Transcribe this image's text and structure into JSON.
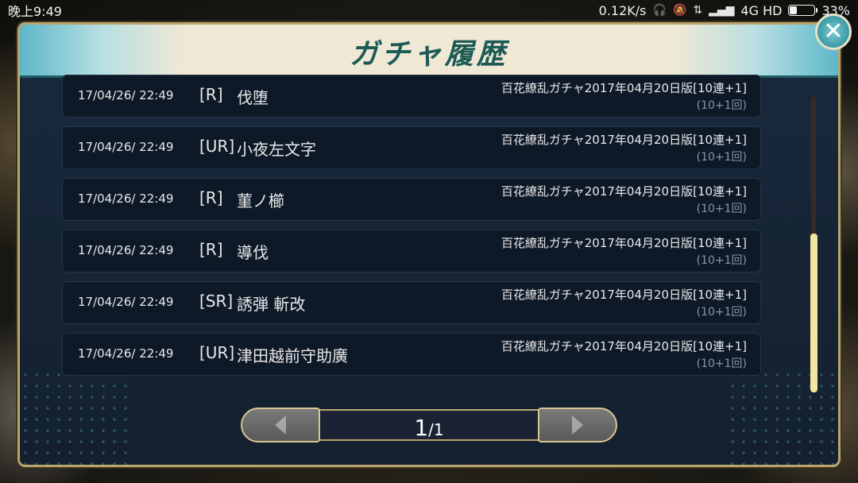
{
  "status_bar": {
    "time": "晚上9:49",
    "net_speed": "0.12K/s",
    "network": "4G HD",
    "battery": "33%",
    "battery_level": 0.33
  },
  "dialog": {
    "title": "ガチャ履歴",
    "close_icon": "close-icon"
  },
  "history": [
    {
      "date": "17/04/26/ 22:49",
      "rarity": "[R]",
      "name": "伐堕",
      "gacha": "百花繚乱ガチャ2017年04月20日版[10連+1]",
      "count": "(10+1回)"
    },
    {
      "date": "17/04/26/ 22:49",
      "rarity": "[UR]",
      "name": "小夜左文字",
      "gacha": "百花繚乱ガチャ2017年04月20日版[10連+1]",
      "count": "(10+1回)"
    },
    {
      "date": "17/04/26/ 22:49",
      "rarity": "[R]",
      "name": "菫ノ櫛",
      "gacha": "百花繚乱ガチャ2017年04月20日版[10連+1]",
      "count": "(10+1回)"
    },
    {
      "date": "17/04/26/ 22:49",
      "rarity": "[R]",
      "name": "導伐",
      "gacha": "百花繚乱ガチャ2017年04月20日版[10連+1]",
      "count": "(10+1回)"
    },
    {
      "date": "17/04/26/ 22:49",
      "rarity": "[SR]",
      "name": "誘弾 斬改",
      "gacha": "百花繚乱ガチャ2017年04月20日版[10連+1]",
      "count": "(10+1回)"
    },
    {
      "date": "17/04/26/ 22:49",
      "rarity": "[UR]",
      "name": "津田越前守助廣",
      "gacha": "百花繚乱ガチャ2017年04月20日版[10連+1]",
      "count": "(10+1回)"
    }
  ],
  "pager": {
    "current": "1",
    "total": "/1",
    "prev_icon": "chevron-left-icon",
    "next_icon": "chevron-right-icon"
  }
}
